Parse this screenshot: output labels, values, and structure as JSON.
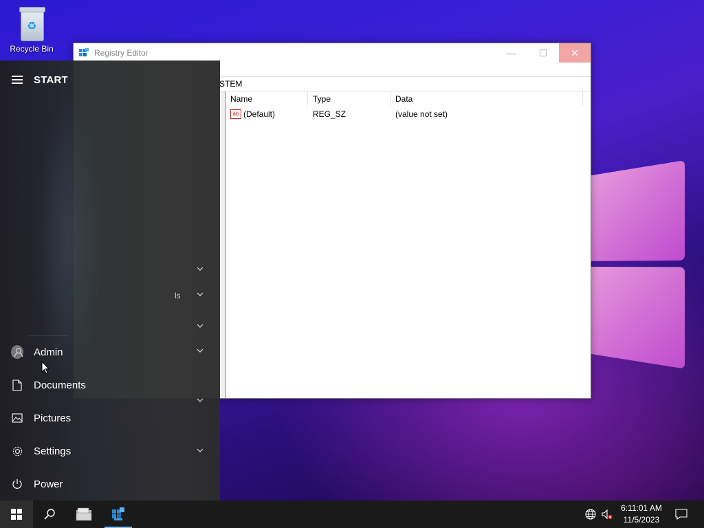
{
  "desktop": {
    "icons": [
      {
        "label": "Recycle Bin",
        "icon": "recycle-bin-icon"
      }
    ]
  },
  "regedit": {
    "title": "Registry Editor",
    "address_fragment": "STEM",
    "columns": [
      "Name",
      "Type",
      "Data"
    ],
    "rows": [
      {
        "name": "(Default)",
        "type": "REG_SZ",
        "data": "(value not set)"
      }
    ],
    "controls": {
      "minimize": "—",
      "maximize": "☐",
      "close": "✕"
    }
  },
  "start_menu": {
    "title": "START",
    "partial_text": "ls",
    "items": [
      {
        "label": "Admin",
        "icon": "user-avatar-icon"
      },
      {
        "label": "Documents",
        "icon": "document-icon"
      },
      {
        "label": "Pictures",
        "icon": "pictures-icon"
      },
      {
        "label": "Settings",
        "icon": "gear-icon"
      },
      {
        "label": "Power",
        "icon": "power-icon"
      }
    ]
  },
  "taskbar": {
    "buttons": [
      "start",
      "search",
      "file-explorer",
      "registry-editor"
    ],
    "clock": {
      "time": "6:11:01 AM",
      "date": "11/5/2023"
    }
  },
  "colors": {
    "accent": "#76b9ed",
    "taskbar": "#1a1a1a",
    "close_hover": "#f1a5a5"
  }
}
